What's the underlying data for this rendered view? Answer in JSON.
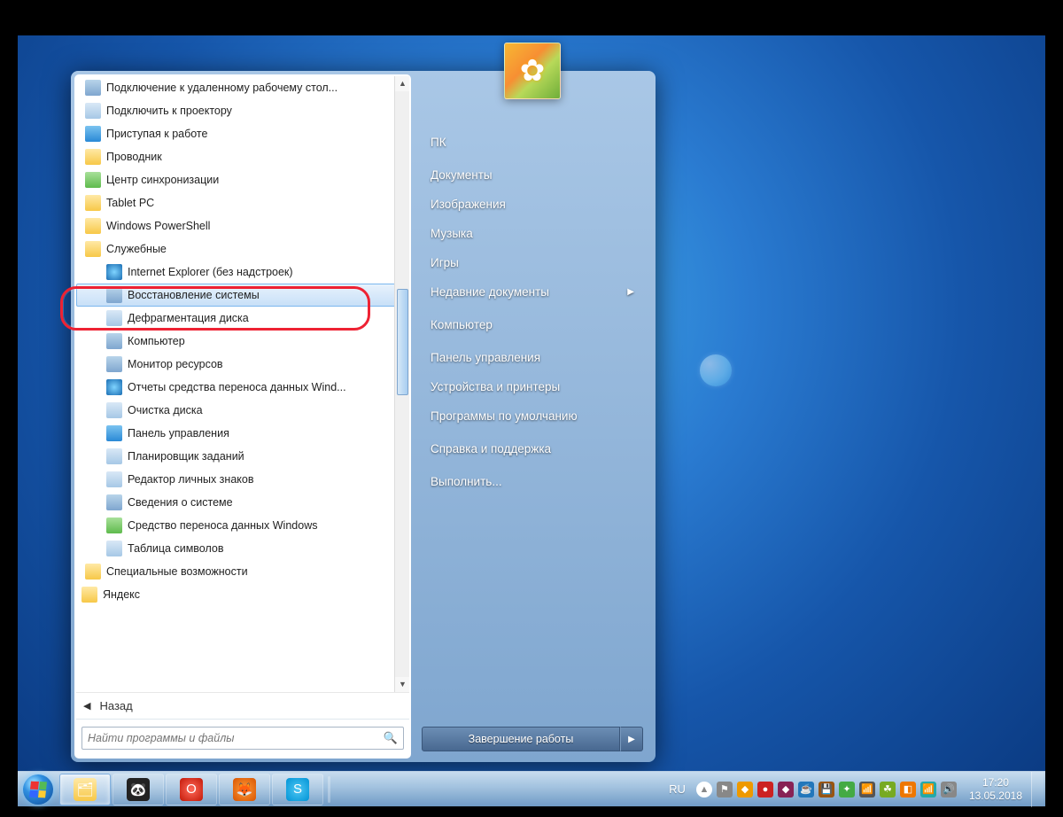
{
  "programs": [
    {
      "label": "Подключение к удаленному рабочему стол...",
      "icon": "ic-monitor",
      "indent": 1
    },
    {
      "label": "Подключить к проектору",
      "icon": "ic-app",
      "indent": 1
    },
    {
      "label": "Приступая к работе",
      "icon": "ic-blue",
      "indent": 1
    },
    {
      "label": "Проводник",
      "icon": "ic-folder",
      "indent": 1
    },
    {
      "label": "Центр синхронизации",
      "icon": "ic-green",
      "indent": 1
    },
    {
      "label": "Tablet PC",
      "icon": "ic-folder",
      "indent": 1
    },
    {
      "label": "Windows PowerShell",
      "icon": "ic-folder",
      "indent": 1
    },
    {
      "label": "Служебные",
      "icon": "ic-folder",
      "indent": 1
    },
    {
      "label": "Internet Explorer (без надстроек)",
      "icon": "ic-globe",
      "indent": 2
    },
    {
      "label": "Восстановление системы",
      "icon": "ic-monitor",
      "indent": 2,
      "hover": true
    },
    {
      "label": "Дефрагментация диска",
      "icon": "ic-app",
      "indent": 2
    },
    {
      "label": "Компьютер",
      "icon": "ic-monitor",
      "indent": 2
    },
    {
      "label": "Монитор ресурсов",
      "icon": "ic-monitor",
      "indent": 2
    },
    {
      "label": "Отчеты средства переноса данных Wind...",
      "icon": "ic-globe",
      "indent": 2
    },
    {
      "label": "Очистка диска",
      "icon": "ic-app",
      "indent": 2
    },
    {
      "label": "Панель управления",
      "icon": "ic-blue",
      "indent": 2
    },
    {
      "label": "Планировщик заданий",
      "icon": "ic-app",
      "indent": 2
    },
    {
      "label": "Редактор личных знаков",
      "icon": "ic-app",
      "indent": 2
    },
    {
      "label": "Сведения о системе",
      "icon": "ic-monitor",
      "indent": 2
    },
    {
      "label": "Средство переноса данных Windows",
      "icon": "ic-green",
      "indent": 2
    },
    {
      "label": "Таблица символов",
      "icon": "ic-app",
      "indent": 2
    },
    {
      "label": "Специальные возможности",
      "icon": "ic-folder",
      "indent": 1
    },
    {
      "label": "Яндекс",
      "icon": "ic-folder",
      "indent": 0
    }
  ],
  "back_label": "Назад",
  "search_placeholder": "Найти программы и файлы",
  "right_items": [
    {
      "label": "ПК"
    },
    {
      "label": "Документы"
    },
    {
      "label": "Изображения"
    },
    {
      "label": "Музыка"
    },
    {
      "label": "Игры"
    },
    {
      "label": "Недавние документы",
      "sub": true
    },
    {
      "label": "Компьютер"
    },
    {
      "label": "Панель управления"
    },
    {
      "label": "Устройства и принтеры"
    },
    {
      "label": "Программы по умолчанию"
    },
    {
      "label": "Справка и поддержка"
    },
    {
      "label": "Выполнить..."
    }
  ],
  "shutdown_label": "Завершение работы",
  "lang": "RU",
  "clock": {
    "time": "17:20",
    "date": "13.05.2018"
  }
}
